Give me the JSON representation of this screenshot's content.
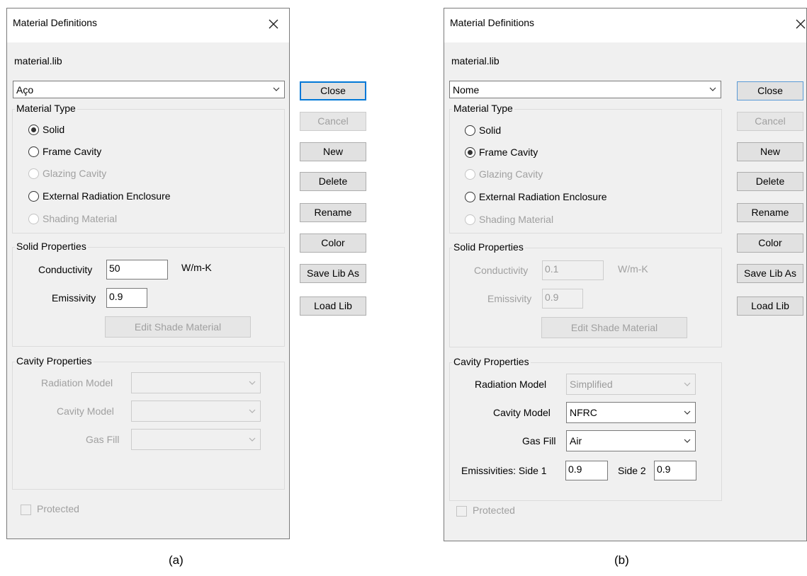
{
  "panel_a": {
    "title": "Material Definitions",
    "library": "material.lib",
    "material_selected": "Aço",
    "buttons": {
      "close": "Close",
      "cancel": "Cancel",
      "new": "New",
      "delete": "Delete",
      "rename": "Rename",
      "color": "Color",
      "save_lib_as": "Save Lib As",
      "load_lib": "Load Lib"
    },
    "material_type": {
      "label": "Material Type",
      "options": [
        "Solid",
        "Frame Cavity",
        "Glazing Cavity",
        "External Radiation Enclosure",
        "Shading Material"
      ],
      "selected": "Solid"
    },
    "solid": {
      "label": "Solid Properties",
      "conductivity_label": "Conductivity",
      "conductivity": "50",
      "unit": "W/m-K",
      "emissivity_label": "Emissivity",
      "emissivity": "0.9",
      "edit_shade": "Edit Shade Material"
    },
    "cavity": {
      "label": "Cavity Properties",
      "radiation_model_label": "Radiation Model",
      "radiation_model": "",
      "cavity_model_label": "Cavity Model",
      "cavity_model": "",
      "gas_fill_label": "Gas Fill",
      "gas_fill": ""
    },
    "protected": "Protected",
    "caption": "(a)"
  },
  "panel_b": {
    "title": "Material Definitions",
    "library": "material.lib",
    "material_selected": "Nome",
    "buttons": {
      "close": "Close",
      "cancel": "Cancel",
      "new": "New",
      "delete": "Delete",
      "rename": "Rename",
      "color": "Color",
      "save_lib_as": "Save Lib As",
      "load_lib": "Load Lib"
    },
    "material_type": {
      "label": "Material Type",
      "options": [
        "Solid",
        "Frame Cavity",
        "Glazing Cavity",
        "External Radiation Enclosure",
        "Shading Material"
      ],
      "selected": "Frame Cavity"
    },
    "solid": {
      "label": "Solid Properties",
      "conductivity_label": "Conductivity",
      "conductivity": "0.1",
      "unit": "W/m-K",
      "emissivity_label": "Emissivity",
      "emissivity": "0.9",
      "edit_shade": "Edit Shade Material"
    },
    "cavity": {
      "label": "Cavity Properties",
      "radiation_model_label": "Radiation Model",
      "radiation_model": "Simplified",
      "cavity_model_label": "Cavity Model",
      "cavity_model": "NFRC",
      "gas_fill_label": "Gas Fill",
      "gas_fill": "Air",
      "emissivities_side1_label": "Emissivities: Side 1",
      "side1": "0.9",
      "side2_label": "Side 2",
      "side2": "0.9"
    },
    "protected": "Protected",
    "caption": "(b)"
  }
}
